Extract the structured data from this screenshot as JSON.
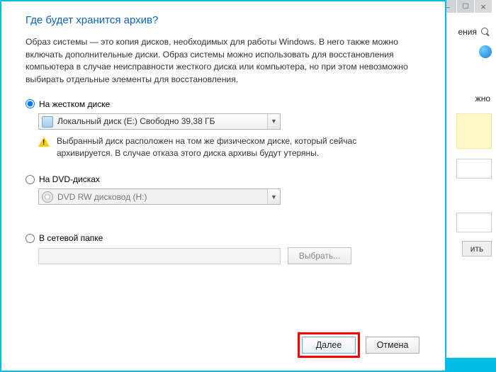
{
  "bg": {
    "row1_text": "ения",
    "row3_text": "жно",
    "btn_text": "ить"
  },
  "dialog": {
    "title": "Где будет хранится архив?",
    "description": "Образ системы — это копия дисков, необходимых для работы Windows. В него также можно включать дополнительные диски. Образ системы можно использовать для восстановления компьютера в случае неисправности жесткого диска или компьютера, но при этом невозможно выбирать отдельные элементы для восстановления."
  },
  "options": {
    "hdd": {
      "label": "На жестком диске",
      "selected": "Локальный диск (E:)  Свободно 39,38 ГБ",
      "warning": "Выбранный диск расположен на том же физическом диске, который сейчас архивируется. В случае отказа этого диска архивы будут утеряны."
    },
    "dvd": {
      "label": "На DVD-дисках",
      "selected": "DVD RW дисковод (H:)"
    },
    "network": {
      "label": "В сетевой папке",
      "browse": "Выбрать..."
    }
  },
  "footer": {
    "next": "Далее",
    "cancel": "Отмена"
  }
}
